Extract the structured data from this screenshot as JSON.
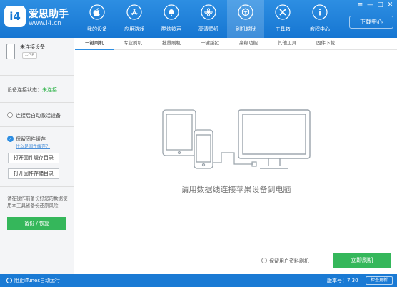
{
  "app": {
    "logo_text": "i4",
    "brand": "爱思助手",
    "url": "www.i4.cn",
    "accent_color": "#1a7ad4",
    "green_color": "#35b75b"
  },
  "nav": {
    "items": [
      {
        "label": "我的设备",
        "icon": "apple-icon"
      },
      {
        "label": "应用游戏",
        "icon": "app-store-icon"
      },
      {
        "label": "酷炫铃声",
        "icon": "bell-icon"
      },
      {
        "label": "高清壁纸",
        "icon": "flower-icon"
      },
      {
        "label": "刷机越狱",
        "icon": "box-icon"
      },
      {
        "label": "工具箱",
        "icon": "tools-icon"
      },
      {
        "label": "教程中心",
        "icon": "info-icon"
      }
    ],
    "active_index": 4,
    "download_center": "下载中心"
  },
  "window": {
    "minimize": "—",
    "restore": "□",
    "close": "✕",
    "menu": "≡"
  },
  "sidebar": {
    "device_name": "未连接设备",
    "device_capacity": "--GB",
    "status_label": "设备连接状态：",
    "status_value": "未连接",
    "auto_activate": "连接后自动激活设备",
    "keep_firmware": "保留固件缓存",
    "what_is_cache": "什么是固件缓存？",
    "open_cache_dir": "打开固件缓存目录",
    "open_storage_dir": "打开固件存储目录",
    "backup_note": "请在操作前备份好您的数据使用本工具省备份还原风险",
    "backup_button": "备份 / 恢复"
  },
  "tabs": [
    "一键刷机",
    "专业刷机",
    "批量刷机",
    "一键越狱",
    "高级功能",
    "其他工具",
    "固件下载"
  ],
  "main": {
    "message": "请用数据线连接苹果设备到电脑",
    "keep_user_data": "保留用户资料刷机",
    "flash_button": "立即刷机"
  },
  "statusbar": {
    "itunes_auto": "阻止iTunes自动运行",
    "version": "版本号：7.30",
    "check_update": "检查更新"
  }
}
